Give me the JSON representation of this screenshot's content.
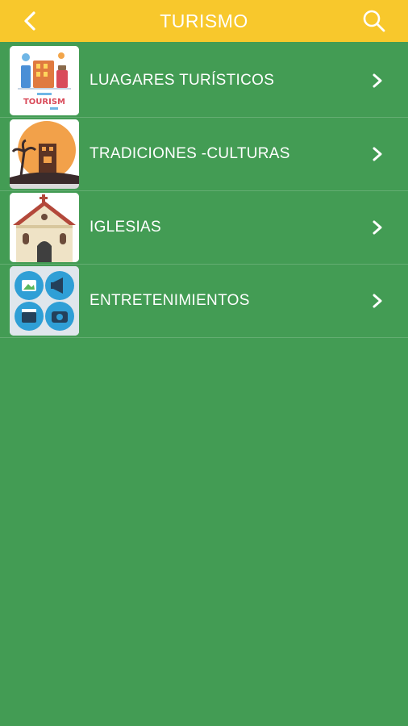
{
  "header": {
    "title": "TURISMO",
    "back_icon": "chevron-left-icon",
    "search_icon": "search-icon",
    "background_color": "#f8c82c"
  },
  "list": {
    "background_color": "#439c54",
    "items": [
      {
        "label": "LUAGARES TURÍSTICOS",
        "thumb_text": "TOURISM",
        "icon": "tourism-thumbnail"
      },
      {
        "label": "TRADICIONES -CULTURAS",
        "icon": "culture-thumbnail"
      },
      {
        "label": "IGLESIAS",
        "icon": "church-thumbnail"
      },
      {
        "label": "ENTRETENIMIENTOS",
        "icon": "entertainment-thumbnail"
      }
    ]
  }
}
